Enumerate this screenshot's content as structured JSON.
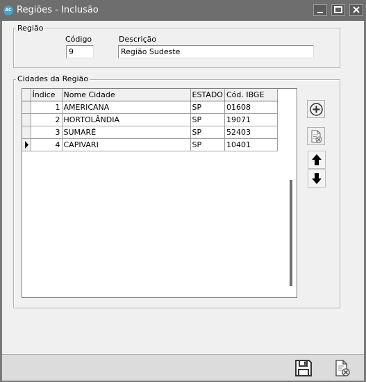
{
  "window": {
    "title": "Regiões - Inclusão",
    "app_icon_text": "AC"
  },
  "regiao_group": {
    "label": "Região",
    "codigo_label": "Código",
    "codigo_value": "9",
    "descricao_label": "Descrição",
    "descricao_value": "Região Sudeste"
  },
  "cidades_group": {
    "label": "Cidades da Região",
    "columns": [
      "Índice",
      "Nome Cidade",
      "ESTADO",
      "Cód. IBGE"
    ],
    "rows": [
      {
        "indice": "1",
        "nome": "AMERICANA",
        "estado": "SP",
        "ibge": "01608",
        "current": false
      },
      {
        "indice": "2",
        "nome": "HORTOLÂNDIA",
        "estado": "SP",
        "ibge": "19071",
        "current": false
      },
      {
        "indice": "3",
        "nome": "SUMARÉ",
        "estado": "SP",
        "ibge": "52403",
        "current": false
      },
      {
        "indice": "4",
        "nome": "CAPIVARI",
        "estado": "SP",
        "ibge": "10401",
        "current": true
      }
    ]
  },
  "icons": {
    "add": "plus-circle-icon",
    "delete": "document-delete-icon",
    "up": "arrow-up-icon",
    "down": "arrow-down-icon",
    "save": "floppy-disk-icon",
    "cancel": "document-cancel-icon"
  },
  "colors": {
    "titlebar": "#6e6e6e",
    "window_bg": "#f0f0f0",
    "footer_bg": "#dcdcdc"
  }
}
